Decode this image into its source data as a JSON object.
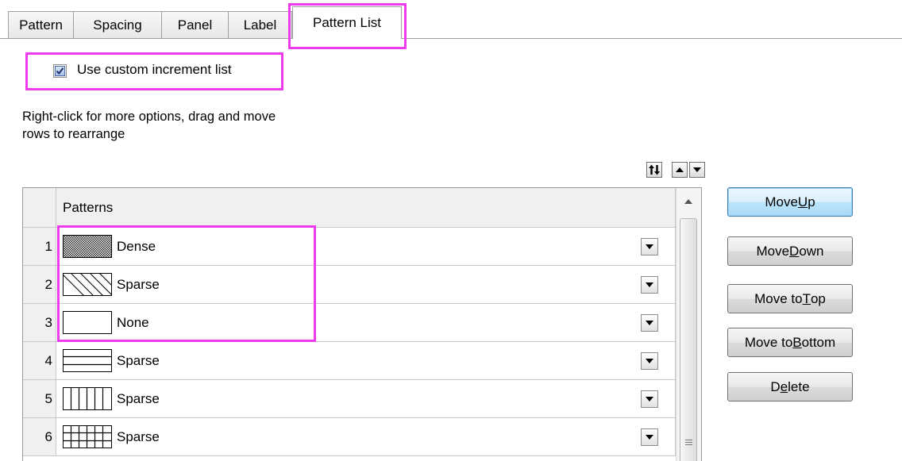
{
  "tabs": [
    {
      "label": "Pattern"
    },
    {
      "label": "Spacing"
    },
    {
      "label": "Panel"
    },
    {
      "label": "Label"
    },
    {
      "label": "Pattern List"
    }
  ],
  "active_tab": "Pattern List",
  "checkbox": {
    "label": "Use custom increment list",
    "checked": true
  },
  "hint_text": {
    "line1": "Right-click for more options, drag and move",
    "line2": "rows to  rearrange"
  },
  "grid": {
    "column_header": "Patterns",
    "rows": [
      {
        "num": "1",
        "pattern": "dense-crosshatch",
        "name": "Dense"
      },
      {
        "num": "2",
        "pattern": "diagonal-lines",
        "name": "Sparse"
      },
      {
        "num": "3",
        "pattern": "none",
        "name": "None"
      },
      {
        "num": "4",
        "pattern": "horizontal-lines",
        "name": "Sparse"
      },
      {
        "num": "5",
        "pattern": "vertical-lines",
        "name": "Sparse"
      },
      {
        "num": "6",
        "pattern": "grid-lines",
        "name": "Sparse"
      }
    ]
  },
  "buttons": {
    "move_up": {
      "pre": "Move ",
      "key": "U",
      "post": "p"
    },
    "move_down": {
      "pre": "Move ",
      "key": "D",
      "post": "own"
    },
    "move_to_top": {
      "pre": "Move to ",
      "key": "T",
      "post": "op"
    },
    "move_to_bottom": {
      "pre": "Move to ",
      "key": "B",
      "post": "ottom"
    },
    "delete": {
      "pre": "D",
      "key": "e",
      "post": "lete"
    }
  },
  "colors": {
    "highlight": "#ee3bee",
    "default_button_border": "#3c7fb1"
  }
}
